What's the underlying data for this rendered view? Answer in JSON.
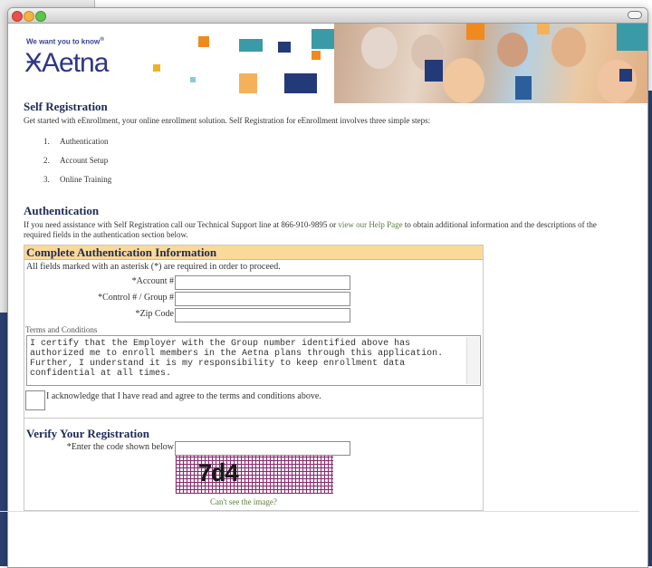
{
  "banner": {
    "tagline": "We want you to know",
    "logo": "Aetna"
  },
  "intro": {
    "title": "Self Registration",
    "text": "Get started with eEnrollment, your online enrollment solution. Self Registration for eEnrollment involves three simple steps:",
    "steps": [
      {
        "num": "1.",
        "label": "Authentication"
      },
      {
        "num": "2.",
        "label": "Account Setup"
      },
      {
        "num": "3.",
        "label": "Online Training"
      }
    ]
  },
  "auth": {
    "title": "Authentication",
    "text_before": "If you need assistance with Self Registration call our Technical Support line at 866-910-9895 or ",
    "link": "view our Help Page",
    "text_after": " to obtain additional information and the descriptions of the required fields in the authentication section below."
  },
  "form": {
    "header": "Complete Authentication Information",
    "required_note": "All fields marked with an asterisk (*) are required in order to proceed.",
    "account_label": "*Account #",
    "control_label": "*Control # / Group #",
    "zip_label": "*Zip Code",
    "terms_label": "Terms and Conditions",
    "terms_text": "I certify that the Employer with the Group number identified above has authorized me to enroll members in the Aetna plans through this application. Further, I understand it is my responsibility to keep enrollment data confidential at all times.",
    "ack_label": "I acknowledge that I have read and agree to the terms and conditions above."
  },
  "verify": {
    "title": "Verify Your Registration",
    "code_label": "*Enter the code shown below",
    "captcha_text": "7d4",
    "cant_see": "Can't see the image?"
  },
  "colors": {
    "navy": "#1f2a57",
    "header_band": "#fbd998",
    "link": "#5b7f3c"
  }
}
